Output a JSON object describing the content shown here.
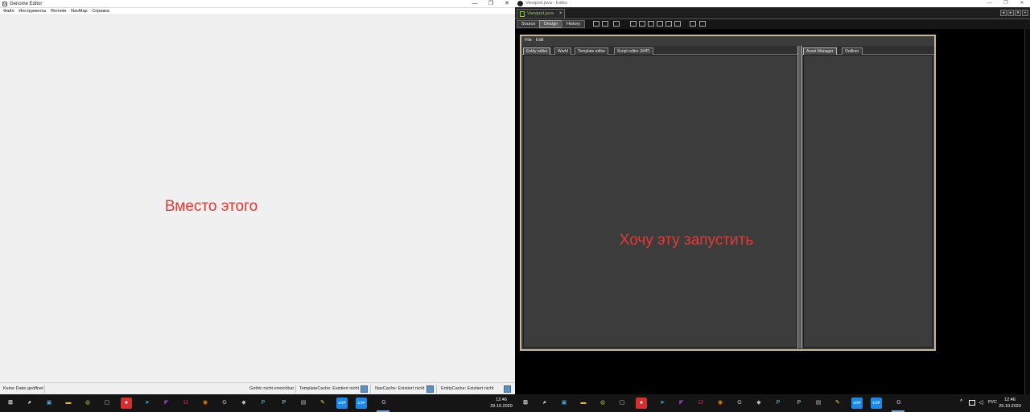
{
  "left_window": {
    "title": "Genome Editor",
    "menu": [
      "Файл",
      "Инструменты",
      "Remote",
      "NavMap",
      "Справка"
    ],
    "caption": "Вместо этого",
    "status": {
      "file": "Keine Datei geöffnet",
      "gothic": "Gothic nicht erreichbar",
      "template_cache": "TemplateCache: Existiert nicht",
      "nav_cache": "NavCache: Existiert nicht",
      "entity_cache": "EntityCache: Existiert nicht"
    },
    "controls": {
      "minimize": "—",
      "maximize": "❐",
      "close": "✕"
    }
  },
  "right_window": {
    "title": "Viewport.java - Editor",
    "controls": {
      "minimize": "—",
      "maximize": "❐",
      "close": "✕"
    },
    "file_tab": "Viewport.java",
    "file_tab_close": "×",
    "nav_buttons": [
      "◂",
      "▸",
      "▾",
      "▪"
    ],
    "toolbar": {
      "source": "Source",
      "design": "Design",
      "history": "History"
    },
    "toolbar_icons": [
      "select-mode-icon",
      "connection-mode-icon",
      "preview-icon",
      "align-left-icon",
      "align-center-icon",
      "align-right-icon",
      "align-top-icon",
      "align-middle-icon",
      "align-bottom-icon",
      "resize-horizontal-icon",
      "resize-vertical-icon"
    ],
    "gui": {
      "menu": [
        "File",
        "Edit"
      ],
      "left_tabs": [
        "Entity editor",
        "World",
        "Template editor",
        "Script editor (WIP)"
      ],
      "right_tabs": [
        "Asset Manager",
        "Outliner"
      ]
    },
    "caption": "Хочу эту запустить"
  },
  "taskbar": {
    "time": "12:46",
    "date": "29.10.2020",
    "language": "РУС",
    "tray_chevron": "^",
    "icons": [
      {
        "name": "windows-start-icon",
        "color": "#ffffff",
        "glyph": "⊞"
      },
      {
        "name": "search-icon",
        "color": "#ffffff",
        "glyph": "⌕"
      },
      {
        "name": "task-view-icon",
        "color": "#4aa3df",
        "glyph": "▣"
      },
      {
        "name": "file-explorer-icon",
        "color": "#e8b339",
        "glyph": "▬"
      },
      {
        "name": "browser-icon",
        "color": "#9bc53d",
        "glyph": "◍"
      },
      {
        "name": "snipping-tool-icon",
        "color": "#cfd8dc",
        "glyph": "▢"
      },
      {
        "name": "red-app-icon",
        "color": "#d32f2f",
        "glyph": "●"
      },
      {
        "name": "telegram-icon",
        "color": "#2ca5e0",
        "glyph": "➤"
      },
      {
        "name": "visual-studio-icon",
        "color": "#8e44ad",
        "glyph": "◤"
      },
      {
        "name": "intellij-icon",
        "color": "#c2185b",
        "glyph": "IJ"
      },
      {
        "name": "blender-icon",
        "color": "#f57c00",
        "glyph": "◉"
      },
      {
        "name": "gothic-icon",
        "color": "#9e9e9e",
        "glyph": "G"
      },
      {
        "name": "unity-icon",
        "color": "#bdbdbd",
        "glyph": "◆"
      },
      {
        "name": "pycharm-icon",
        "color": "#26a69a",
        "glyph": "P"
      },
      {
        "name": "pycharm-alt-icon",
        "color": "#4db6ac",
        "glyph": "P"
      },
      {
        "name": "archive-icon",
        "color": "#bdbdbd",
        "glyph": "▤"
      },
      {
        "name": "paint-icon",
        "color": "#ffca28",
        "glyph": "✎"
      },
      {
        "name": "utp-app-icon",
        "color": "#1e88e5",
        "glyph": "UTP"
      },
      {
        "name": "ctp-app-icon",
        "color": "#1e88e5",
        "glyph": "CTP"
      },
      {
        "name": "genome-icon",
        "color": "#9e9e9e",
        "glyph": "G"
      }
    ],
    "tray_icons": [
      "network-icon",
      "volume-icon"
    ]
  }
}
